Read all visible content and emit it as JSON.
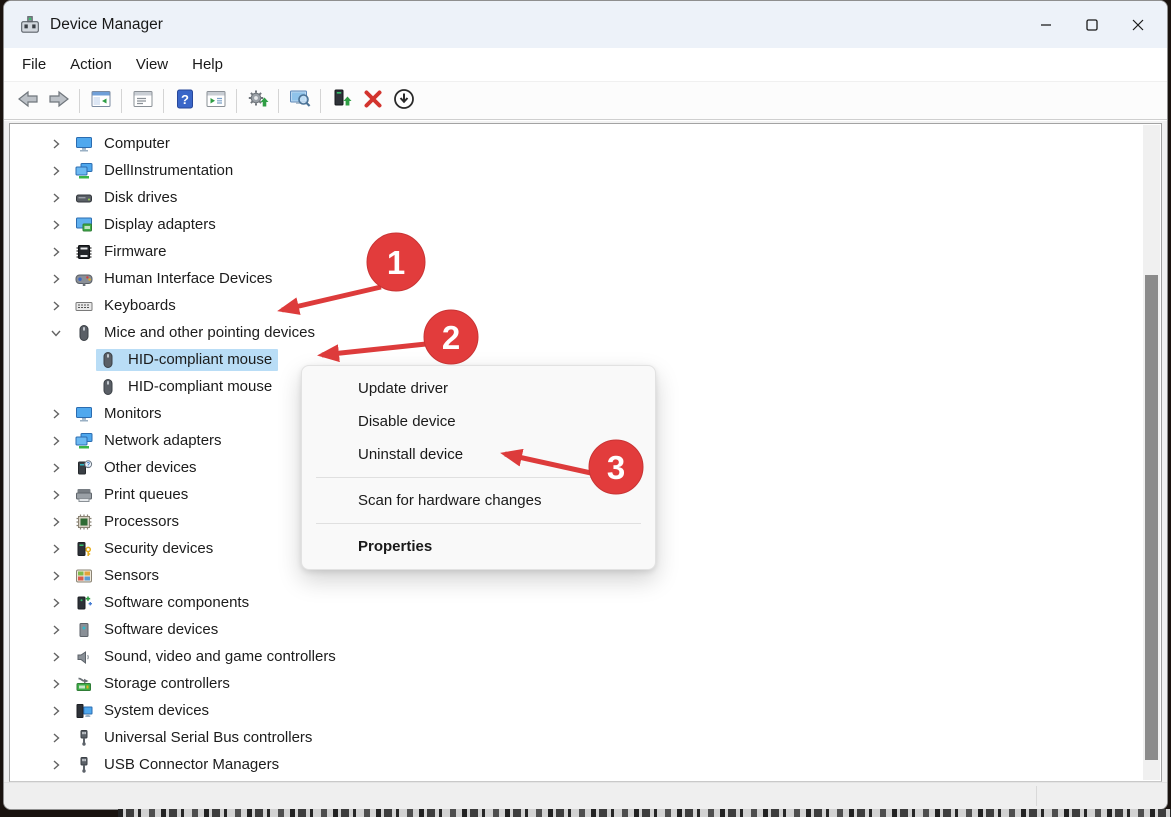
{
  "window": {
    "title": "Device Manager",
    "controls": [
      {
        "name": "minimize",
        "icon": "minimize-icon"
      },
      {
        "name": "maximize",
        "icon": "maximize-icon"
      },
      {
        "name": "close",
        "icon": "close-icon"
      }
    ]
  },
  "menu_bar": {
    "items": [
      "File",
      "Action",
      "View",
      "Help"
    ]
  },
  "toolbar": {
    "buttons": [
      {
        "name": "back",
        "icon": "arrow-left-icon"
      },
      {
        "name": "forward",
        "icon": "arrow-right-icon"
      },
      {
        "type": "separator"
      },
      {
        "name": "show-console-tree",
        "icon": "console-tree-icon"
      },
      {
        "type": "separator"
      },
      {
        "name": "properties-pane",
        "icon": "list-window-icon"
      },
      {
        "type": "separator"
      },
      {
        "name": "help",
        "icon": "help-icon"
      },
      {
        "name": "action-pane",
        "icon": "action-pane-icon"
      },
      {
        "type": "separator"
      },
      {
        "name": "update-driver",
        "icon": "gear-up-icon"
      },
      {
        "type": "separator"
      },
      {
        "name": "scan-hardware-changes",
        "icon": "scan-icon"
      },
      {
        "type": "separator"
      },
      {
        "name": "update-device-driver",
        "icon": "device-up-icon"
      },
      {
        "name": "uninstall-device",
        "icon": "uninstall-x-icon"
      },
      {
        "name": "disable-device",
        "icon": "disable-icon"
      }
    ]
  },
  "tree": {
    "items": [
      {
        "label": "Computer",
        "icon": "computer-icon",
        "level": 0,
        "state": "collapsed",
        "selected": false
      },
      {
        "label": "DellInstrumentation",
        "icon": "dell-instrumentation-icon",
        "level": 0,
        "state": "collapsed",
        "selected": false
      },
      {
        "label": "Disk drives",
        "icon": "disk-drives-icon",
        "level": 0,
        "state": "collapsed",
        "selected": false
      },
      {
        "label": "Display adapters",
        "icon": "display-adapters-icon",
        "level": 0,
        "state": "collapsed",
        "selected": false
      },
      {
        "label": "Firmware",
        "icon": "firmware-icon",
        "level": 0,
        "state": "collapsed",
        "selected": false
      },
      {
        "label": "Human Interface Devices",
        "icon": "hid-icon",
        "level": 0,
        "state": "collapsed",
        "selected": false
      },
      {
        "label": "Keyboards",
        "icon": "keyboard-icon",
        "level": 0,
        "state": "collapsed",
        "selected": false
      },
      {
        "label": "Mice and other pointing devices",
        "icon": "mouse-icon",
        "level": 0,
        "state": "expanded",
        "selected": false
      },
      {
        "label": "HID-compliant mouse",
        "icon": "mouse-icon",
        "level": 1,
        "state": "none",
        "selected": true
      },
      {
        "label": "HID-compliant mouse",
        "icon": "mouse-icon",
        "level": 1,
        "state": "none",
        "selected": false
      },
      {
        "label": "Monitors",
        "icon": "monitor-icon",
        "level": 0,
        "state": "collapsed",
        "selected": false
      },
      {
        "label": "Network adapters",
        "icon": "network-adapters-icon",
        "level": 0,
        "state": "collapsed",
        "selected": false
      },
      {
        "label": "Other devices",
        "icon": "other-devices-icon",
        "level": 0,
        "state": "collapsed",
        "selected": false
      },
      {
        "label": "Print queues",
        "icon": "print-queues-icon",
        "level": 0,
        "state": "collapsed",
        "selected": false
      },
      {
        "label": "Processors",
        "icon": "processors-icon",
        "level": 0,
        "state": "collapsed",
        "selected": false
      },
      {
        "label": "Security devices",
        "icon": "security-devices-icon",
        "level": 0,
        "state": "collapsed",
        "selected": false
      },
      {
        "label": "Sensors",
        "icon": "sensors-icon",
        "level": 0,
        "state": "collapsed",
        "selected": false
      },
      {
        "label": "Software components",
        "icon": "software-components-icon",
        "level": 0,
        "state": "collapsed",
        "selected": false
      },
      {
        "label": "Software devices",
        "icon": "software-devices-icon",
        "level": 0,
        "state": "collapsed",
        "selected": false
      },
      {
        "label": "Sound, video and game controllers",
        "icon": "sound-icon",
        "level": 0,
        "state": "collapsed",
        "selected": false
      },
      {
        "label": "Storage controllers",
        "icon": "storage-controllers-icon",
        "level": 0,
        "state": "collapsed",
        "selected": false
      },
      {
        "label": "System devices",
        "icon": "system-devices-icon",
        "level": 0,
        "state": "collapsed",
        "selected": false
      },
      {
        "label": "Universal Serial Bus controllers",
        "icon": "usb-icon",
        "level": 0,
        "state": "collapsed",
        "selected": false
      },
      {
        "label": "USB Connector Managers",
        "icon": "usb-icon",
        "level": 0,
        "state": "collapsed",
        "selected": false
      }
    ]
  },
  "context_menu": {
    "items": [
      {
        "label": "Update driver"
      },
      {
        "label": "Disable device"
      },
      {
        "label": "Uninstall device"
      },
      {
        "type": "separator"
      },
      {
        "label": "Scan for hardware changes"
      },
      {
        "type": "separator"
      },
      {
        "label": "Properties",
        "bold": true
      }
    ]
  },
  "annotations": {
    "color": "#e23c3c",
    "badges": [
      {
        "number": "1"
      },
      {
        "number": "2"
      },
      {
        "number": "3"
      }
    ]
  },
  "colors": {
    "selection": "#b9ddf6",
    "titlebar": "#edf2f9",
    "annotation_red": "#e23c3c"
  }
}
